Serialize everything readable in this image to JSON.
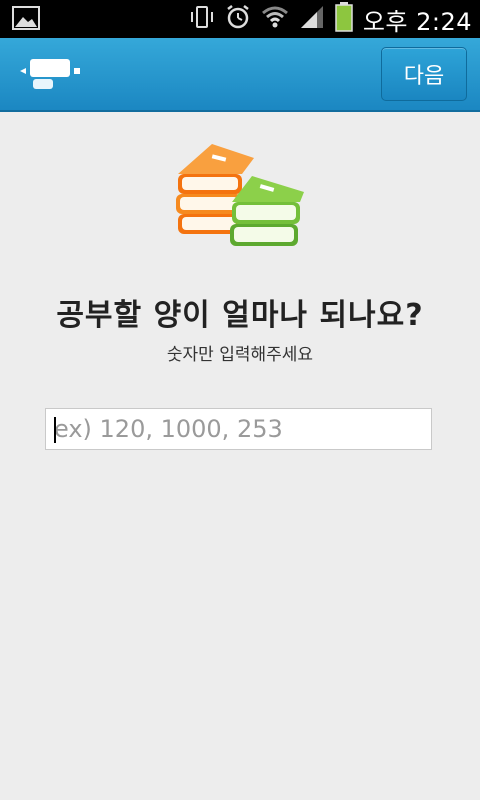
{
  "status_bar": {
    "time": "오후 2:24",
    "icons": [
      "gallery-icon",
      "vibrate-icon",
      "alarm-icon",
      "wifi-icon",
      "signal-icon",
      "battery-icon"
    ],
    "battery_color": "#8dc63f"
  },
  "action_bar": {
    "icon": "app-logo-icon",
    "next_label": "다음",
    "accent": "#1f95cf"
  },
  "main": {
    "illustration": "books-icon",
    "question": "공부할 양이 얼마나 되나요?",
    "hint": "숫자만 입력해주세요",
    "amount_input": {
      "value": "",
      "placeholder": "ex) 120, 1000, 253"
    }
  }
}
